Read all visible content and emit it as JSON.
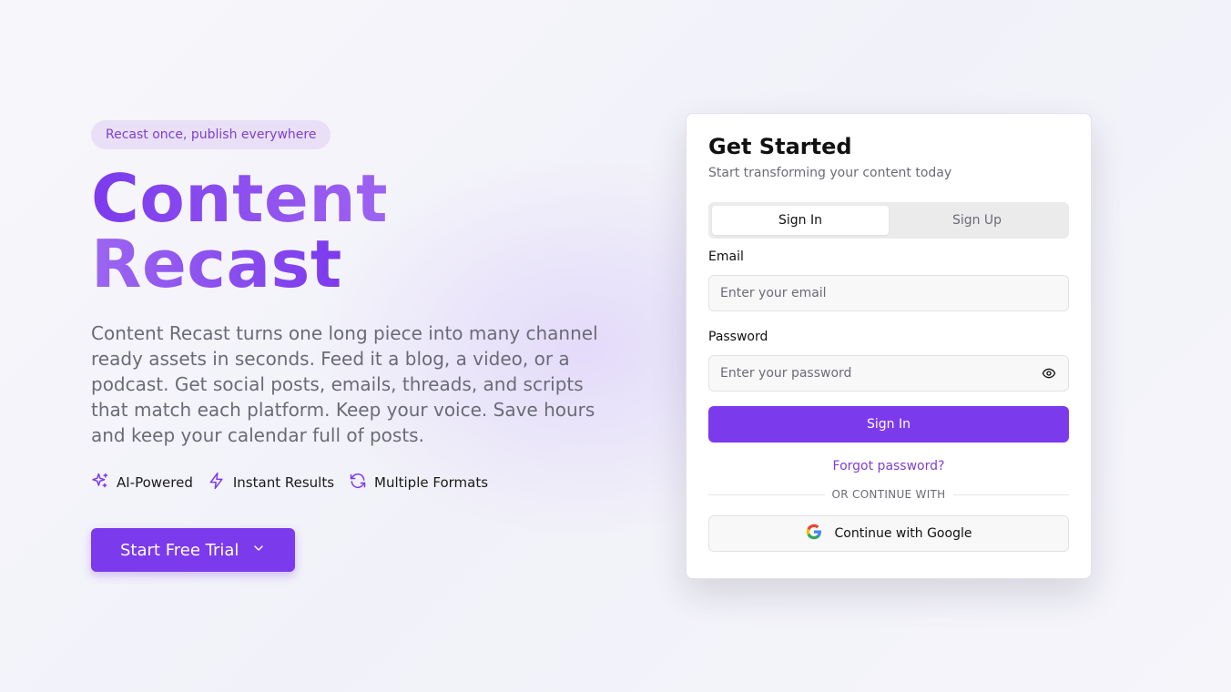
{
  "hero": {
    "tagline": "Recast once, publish everywhere",
    "title_line1": "Content",
    "title_line2": "Recast",
    "description": "Content Recast turns one long piece into many channel ready assets in seconds. Feed it a blog, a video, or a podcast. Get social posts, emails, threads, and scripts that match each platform. Keep your voice. Save hours and keep your calendar full of posts.",
    "features": [
      {
        "icon": "sparkles-icon",
        "label": "AI-Powered"
      },
      {
        "icon": "lightning-icon",
        "label": "Instant Results"
      },
      {
        "icon": "refresh-icon",
        "label": "Multiple Formats"
      }
    ],
    "cta_label": "Start Free Trial"
  },
  "auth": {
    "title": "Get Started",
    "subtitle": "Start transforming your content today",
    "tabs": [
      {
        "label": "Sign In",
        "active": true
      },
      {
        "label": "Sign Up",
        "active": false
      }
    ],
    "email_label": "Email",
    "email_placeholder": "Enter your email",
    "email_value": "",
    "password_label": "Password",
    "password_placeholder": "Enter your password",
    "password_value": "",
    "submit_label": "Sign In",
    "forgot_label": "Forgot password?",
    "divider_text": "OR CONTINUE WITH",
    "google_label": "Continue with Google"
  },
  "colors": {
    "accent": "#7c3aed",
    "tagline_bg": "#e9e0f7",
    "muted_text": "#6b6b78"
  }
}
